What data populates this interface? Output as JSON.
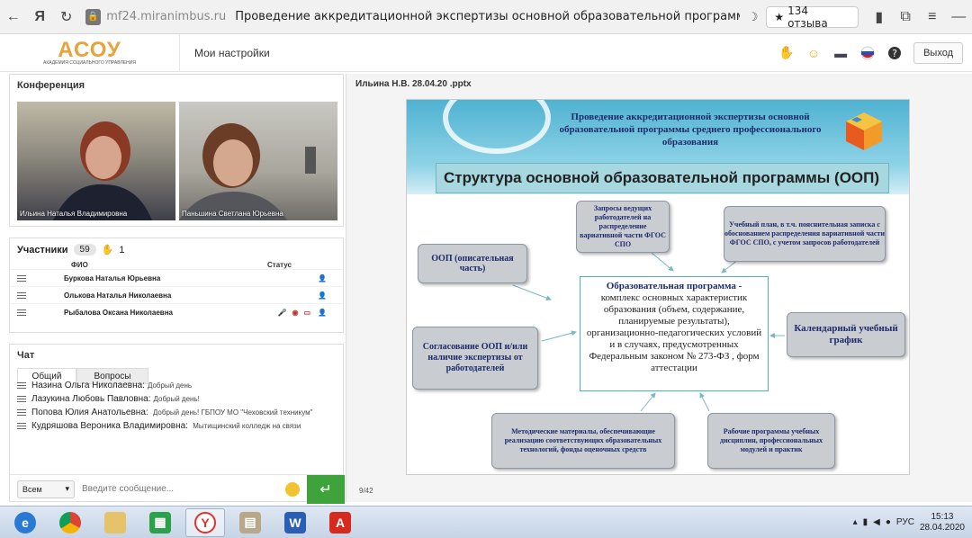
{
  "browser": {
    "back_icon": "back-arrow-icon",
    "domain": "mf24.miranimbus.ru",
    "page_title": "Проведение аккредитационной экспертизы основной образовательной программы ср...",
    "reviews": "134 отзыва"
  },
  "header": {
    "logo_text": "АСОУ",
    "logo_sub": "АКАДЕМИЯ СОЦИАЛЬНОГО УПРАВЛЕНИЯ",
    "my_settings": "Мои настройки",
    "exit": "Выход"
  },
  "conference": {
    "title": "Конференция",
    "videos": [
      {
        "name": "Ильина Наталья Владимировна"
      },
      {
        "name": "Паньшина Светлана Юрьевна"
      }
    ]
  },
  "participants": {
    "title": "Участники",
    "count": "59",
    "hands": "1",
    "col_name": "ФИО",
    "col_status": "Статус",
    "rows": [
      {
        "name": "Буркова Наталья Юрьевна"
      },
      {
        "name": "Олькова Наталья Николаевна"
      },
      {
        "name": "Рыбалова  Оксана   Николаевна"
      }
    ]
  },
  "chat": {
    "title": "Чат",
    "tab_general": "Общий",
    "tab_questions": "Вопросы",
    "messages": [
      {
        "name": "Назина Ольга Николаевна:",
        "text": "Добрый день"
      },
      {
        "name": "Лазукина Любовь Павловна:",
        "text": "Добрый день!"
      },
      {
        "name": "Попова Юлия Анатольевна:",
        "text": "Добрый день! ГБПОУ МО \"Чеховский техникум\""
      },
      {
        "name": "Кудряшова Вероника Владимировна:",
        "text": "Мытищинский колледж на связи"
      }
    ],
    "select_value": "Всем",
    "input_placeholder": "Введите сообщение..."
  },
  "presentation": {
    "file_title": "Ильина Н.В. 28.04.20 .pptx",
    "page": "9/42",
    "heading": "Проведение аккредитационной экспертизы основной образовательной программы среднего профессионального образования",
    "structure_title": "Структура основной образовательной программы (ООП)",
    "box_oop": "ООП (описательная часть)",
    "box_requests": "Запросы ведущих работодателей на распределение вариативной части ФГОС СПО",
    "box_plan": "Учебный план, в т.ч. пояснительная записка с обоснованием распределения вариативной части ФГОС СПО, с учетом запросов работодателей",
    "box_agreement": "Согласование ООП и/или наличие экспертизы от работодателей",
    "box_calendar": "Календарный учебный график",
    "box_methods": "Методические материалы, обеспечивающие реализацию соответствующих образовательных технологий, фонды оценочных средств",
    "box_programs": "Рабочие программы учебных дисциплин, профессиональных модулей и практик",
    "center_bold": "Образовательная  программа -",
    "center_text": "комплекс основных характеристик образования (объем, содержание, планируемые результаты), организационно-педагогических условий и в случаях, предусмотренных Федеральным законом № 273-ФЗ , форм аттестации"
  },
  "taskbar": {
    "lang": "РУС",
    "time": "15:13",
    "date": "28.04.2020"
  }
}
